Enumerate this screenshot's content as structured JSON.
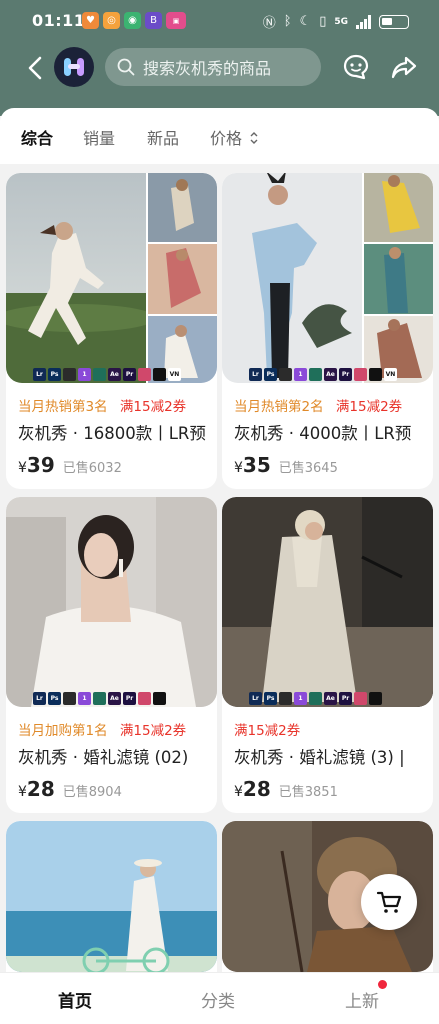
{
  "status": {
    "time": "01:11",
    "network": "5G"
  },
  "nav": {
    "search_placeholder": "搜索灰机秀的商品"
  },
  "sort": {
    "items": [
      "综合",
      "销量",
      "新品",
      "价格"
    ],
    "active_index": 0
  },
  "badge_icons": [
    "Lr",
    "Ps",
    "",
    "1",
    "",
    "Ae",
    "Pr",
    "",
    "",
    "VN"
  ],
  "products": [
    {
      "tag_rank": "当月热销第3名",
      "tag_coupon": "满15减2券",
      "title": "灰机秀 · 16800款丨LR预",
      "currency": "¥",
      "price": "39",
      "sold": "已售6032"
    },
    {
      "tag_rank": "当月热销第2名",
      "tag_coupon": "满15减2券",
      "title": "灰机秀 · 4000款丨LR预",
      "currency": "¥",
      "price": "35",
      "sold": "已售3645"
    },
    {
      "tag_rank": "当月加购第1名",
      "tag_coupon": "满15减2券",
      "title": "灰机秀 · 婚礼滤镜 (02)",
      "currency": "¥",
      "price": "28",
      "sold": "已售8904"
    },
    {
      "tag_rank": "",
      "tag_coupon": "满15减2券",
      "title": "灰机秀 · 婚礼滤镜 (3) |",
      "currency": "¥",
      "price": "28",
      "sold": "已售3851"
    }
  ],
  "tabbar": {
    "items": [
      "首页",
      "分类",
      "上新"
    ],
    "active_index": 0
  },
  "colors": {
    "header_bg": "#5b7a70",
    "tag_rank": "#e08a2a",
    "tag_coupon": "#e8332a",
    "badge_dot": "#f0263c"
  }
}
